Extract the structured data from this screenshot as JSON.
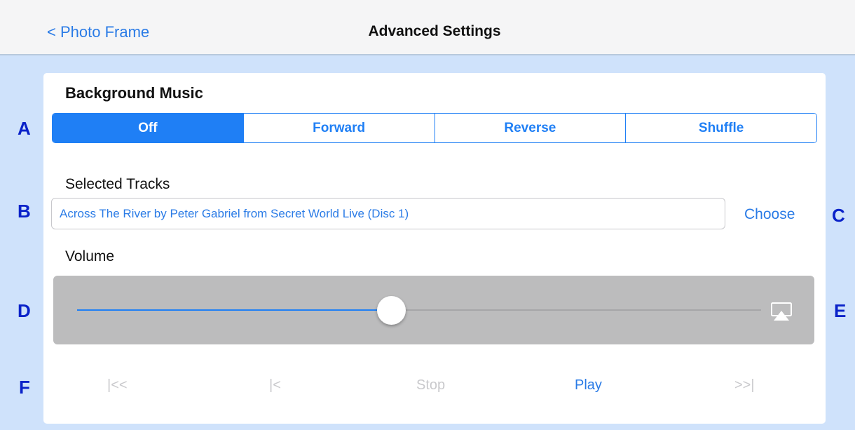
{
  "nav": {
    "back_label": "< Photo Frame",
    "title": "Advanced Settings"
  },
  "background_music": {
    "heading": "Background Music",
    "segments": [
      "Off",
      "Forward",
      "Reverse",
      "Shuffle"
    ],
    "selected": "Off"
  },
  "tracks": {
    "label": "Selected Tracks",
    "value": "Across The River by Peter Gabriel from Secret World Live (Disc 1)",
    "choose_label": "Choose"
  },
  "volume": {
    "label": "Volume",
    "level_fraction": 0.46,
    "icon": "airplay-icon"
  },
  "transport": {
    "skip_to_start": "|<<",
    "previous": "|<",
    "stop": "Stop",
    "play": "Play",
    "skip_to_end": ">>|"
  },
  "markers": [
    "A",
    "B",
    "C",
    "D",
    "E",
    "F"
  ],
  "colors": {
    "accent": "#1f7ff5",
    "link": "#2a7be6",
    "background": "#cfe2fb",
    "marker": "#0a22c9",
    "disabled": "#c9c9cc"
  }
}
